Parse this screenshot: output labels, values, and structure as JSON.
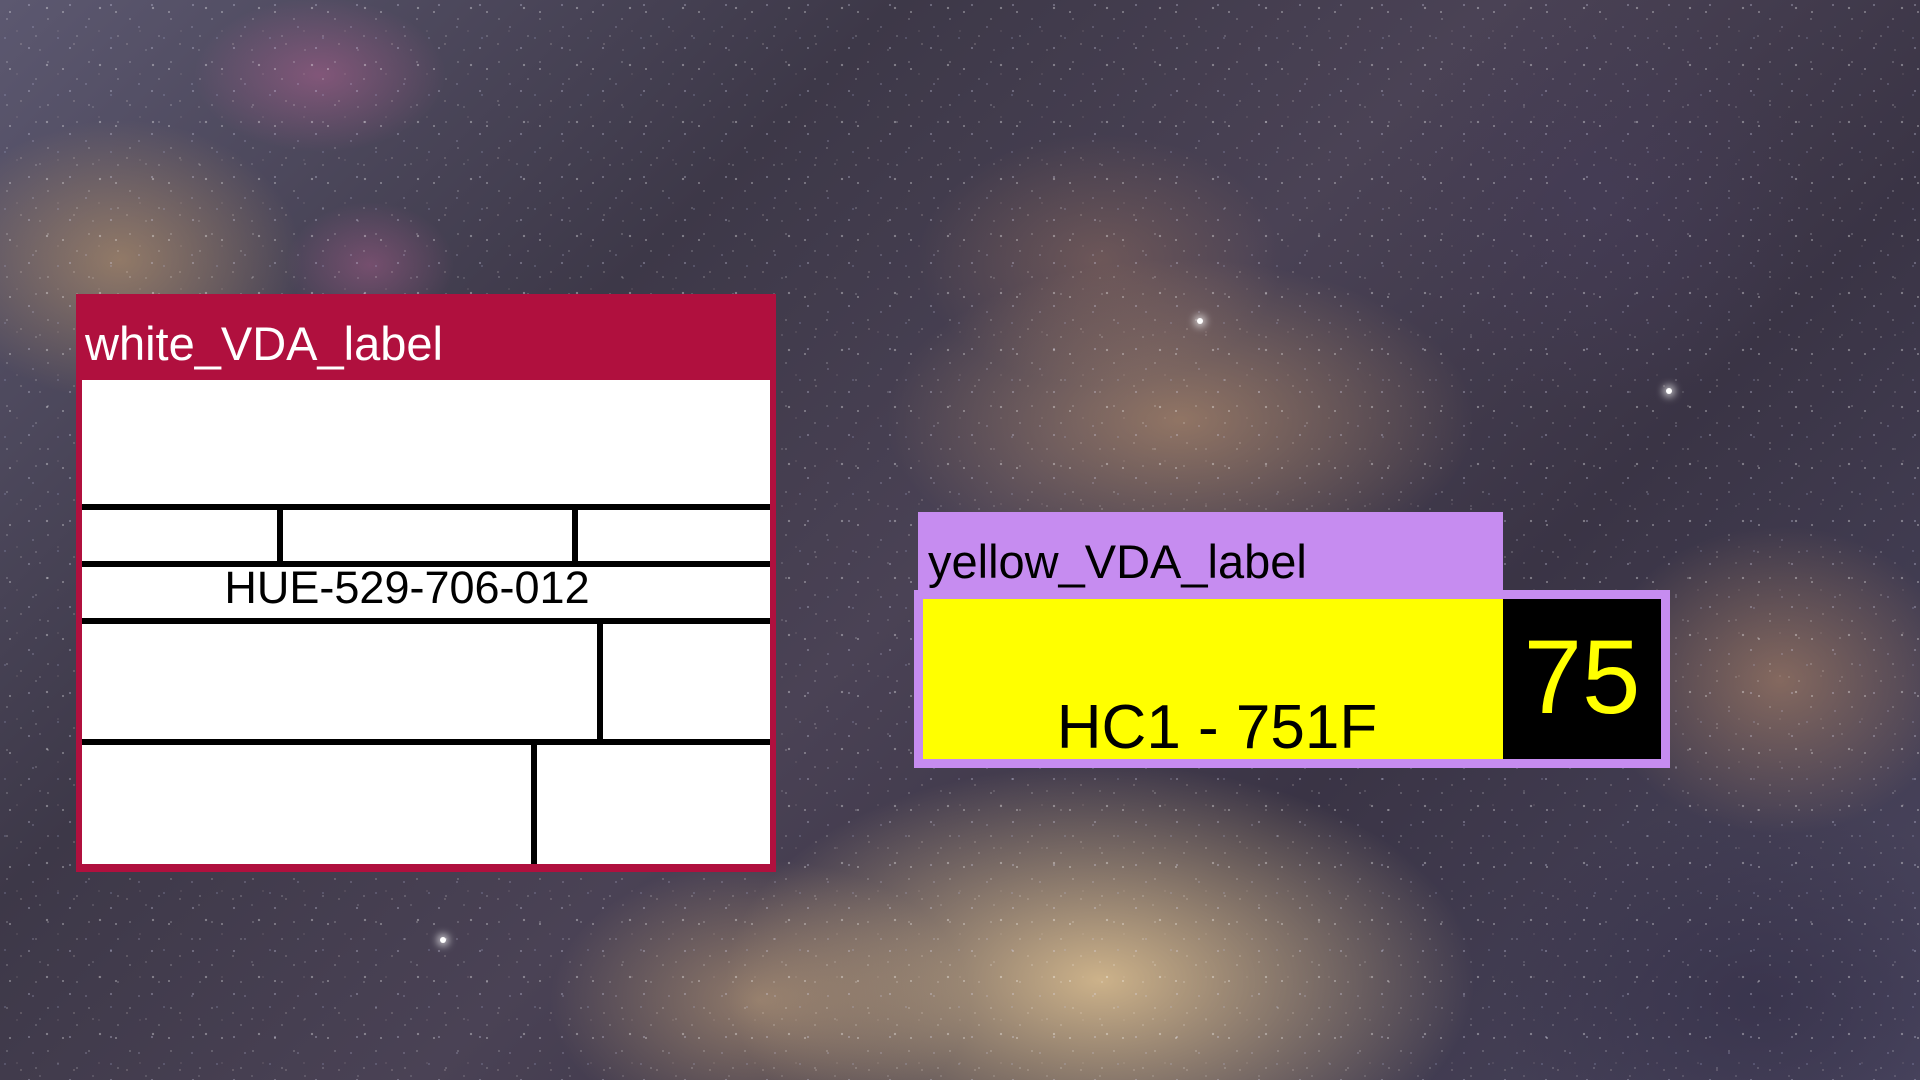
{
  "background": {
    "description_icon": "milky-way-starfield"
  },
  "white_label": {
    "caption": "white_VDA_label",
    "part_number": "HUE-529-706-012",
    "colors": {
      "frame": "#b0103e",
      "caption_text": "#ffffff",
      "body": "#ffffff",
      "lines": "#000000"
    }
  },
  "yellow_label": {
    "caption": "yellow_VDA_label",
    "code": "HC1 - 751F",
    "number": "75",
    "colors": {
      "frame": "#c68cf0",
      "body": "#ffff00",
      "number_box": "#000000",
      "number_text": "#ffff00"
    }
  }
}
